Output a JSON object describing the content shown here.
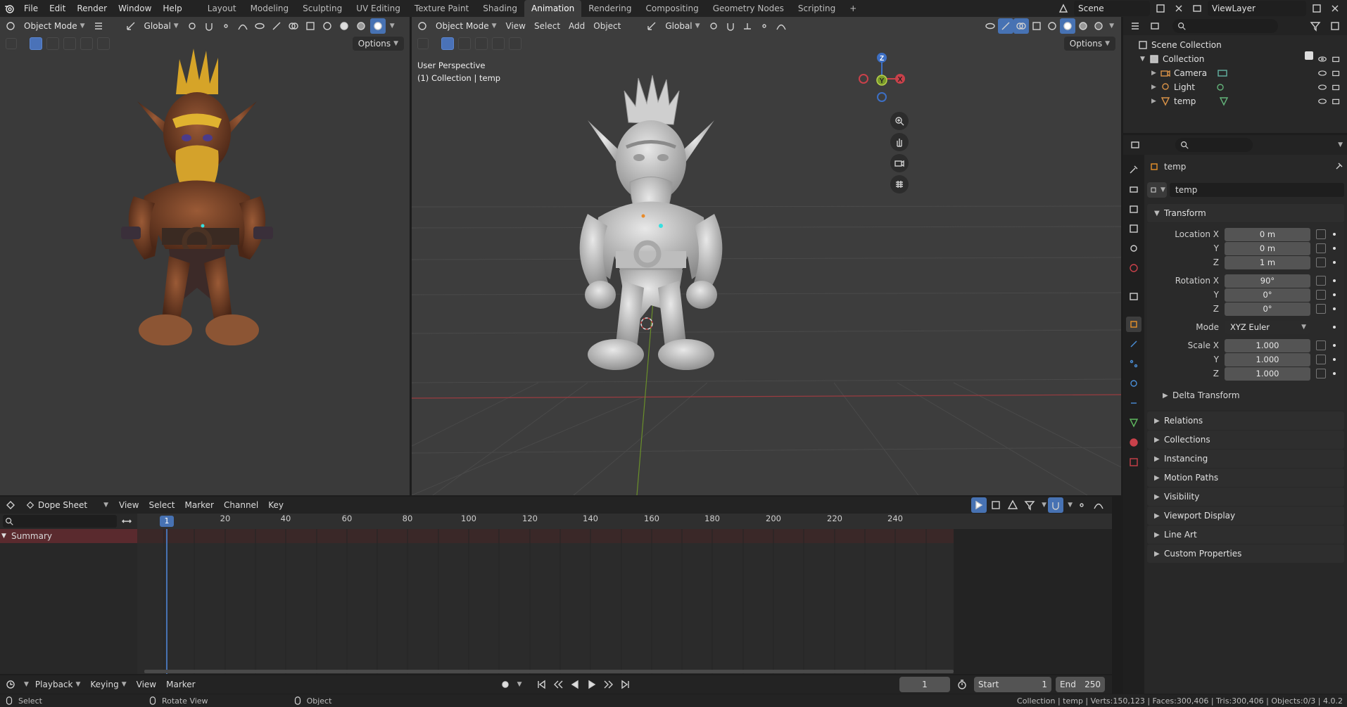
{
  "topbar": {
    "menus": [
      "File",
      "Edit",
      "Render",
      "Window",
      "Help"
    ],
    "workspaces": [
      "Layout",
      "Modeling",
      "Sculpting",
      "UV Editing",
      "Texture Paint",
      "Shading",
      "Animation",
      "Rendering",
      "Compositing",
      "Geometry Nodes",
      "Scripting"
    ],
    "active_workspace": "Animation",
    "add_tab": "+",
    "scene_name": "Scene",
    "view_layer": "ViewLayer"
  },
  "left_viewport": {
    "mode": "Object Mode",
    "orientation": "Global",
    "options": "Options"
  },
  "main_viewport": {
    "mode": "Object Mode",
    "menus": [
      "View",
      "Select",
      "Add",
      "Object"
    ],
    "orientation": "Global",
    "options": "Options",
    "overlay_line1": "User Perspective",
    "overlay_line2": "(1) Collection | temp",
    "gizmo": {
      "x": "X",
      "y": "Y",
      "z": "Z"
    }
  },
  "outliner": {
    "root": "Scene Collection",
    "collection": "Collection",
    "items": [
      {
        "name": "Camera",
        "color": "#d99247"
      },
      {
        "name": "Light",
        "color": "#d99247"
      },
      {
        "name": "temp",
        "color": "#d99247"
      }
    ]
  },
  "properties": {
    "object_name": "temp",
    "data_name": "temp",
    "transform_title": "Transform",
    "location": {
      "label_x": "Location X",
      "label_y": "Y",
      "label_z": "Z",
      "x": "0 m",
      "y": "0 m",
      "z": "1 m"
    },
    "rotation": {
      "label_x": "Rotation X",
      "label_y": "Y",
      "label_z": "Z",
      "x": "90°",
      "y": "0°",
      "z": "0°"
    },
    "mode": {
      "label": "Mode",
      "value": "XYZ Euler"
    },
    "scale": {
      "label_x": "Scale X",
      "label_y": "Y",
      "label_z": "Z",
      "x": "1.000",
      "y": "1.000",
      "z": "1.000"
    },
    "delta_transform": "Delta Transform",
    "sections": [
      "Relations",
      "Collections",
      "Instancing",
      "Motion Paths",
      "Visibility",
      "Viewport Display",
      "Line Art",
      "Custom Properties"
    ]
  },
  "dopesheet": {
    "editor": "Dope Sheet",
    "menus": [
      "View",
      "Select",
      "Marker",
      "Channel",
      "Key"
    ],
    "summary": "Summary",
    "current_frame": "1",
    "ruler": [
      "20",
      "40",
      "60",
      "80",
      "100",
      "120",
      "140",
      "160",
      "180",
      "200",
      "220",
      "240"
    ]
  },
  "timeline": {
    "menus": [
      "Playback",
      "Keying",
      "View",
      "Marker"
    ],
    "current_frame": "1",
    "start_label": "Start",
    "start_value": "1",
    "end_label": "End",
    "end_value": "250"
  },
  "statusbar": {
    "select": "Select",
    "rotate": "Rotate View",
    "object": "Object",
    "stats": "Collection | temp | Verts:150,123 | Faces:300,406 | Tris:300,406 | Objects:0/3 | 4.0.2"
  },
  "colors": {
    "accent": "#4772b3",
    "bg": "#303030",
    "x_axis": "#c9414a",
    "y_axis": "#7a9a2a",
    "z_axis": "#3d6fc4"
  }
}
